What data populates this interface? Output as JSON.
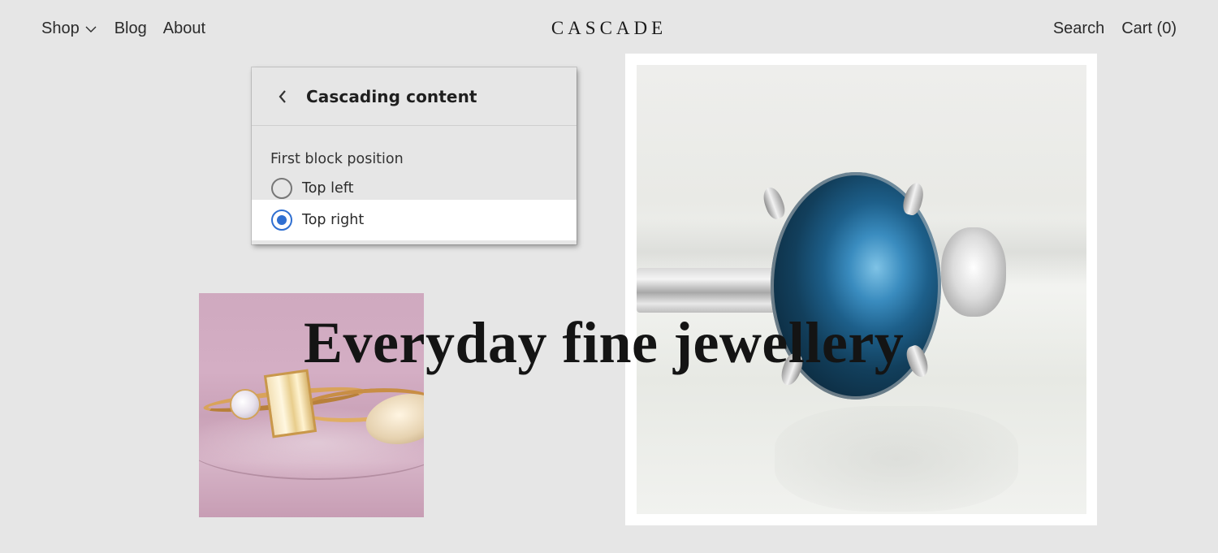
{
  "header": {
    "nav_left": [
      {
        "label": "Shop",
        "has_dropdown": true
      },
      {
        "label": "Blog"
      },
      {
        "label": "About"
      }
    ],
    "logo": "CASCADE",
    "nav_right": [
      {
        "label": "Search"
      },
      {
        "label": "Cart (0)"
      }
    ]
  },
  "hero": {
    "title": "Everyday fine jewellery",
    "images": [
      {
        "name": "gold-rings-on-pink",
        "description": "Gold rings with emerald-cut, round and marquise diamonds on pink glass"
      },
      {
        "name": "sapphire-ring",
        "description": "White gold ring with oval blue sapphire and side diamond"
      }
    ]
  },
  "panel": {
    "back_icon": "chevron-left-icon",
    "title": "Cascading content",
    "field_label": "First block position",
    "options": [
      {
        "label": "Top left",
        "selected": false
      },
      {
        "label": "Top right",
        "selected": true
      }
    ],
    "accent_color": "#2f6fd1"
  }
}
